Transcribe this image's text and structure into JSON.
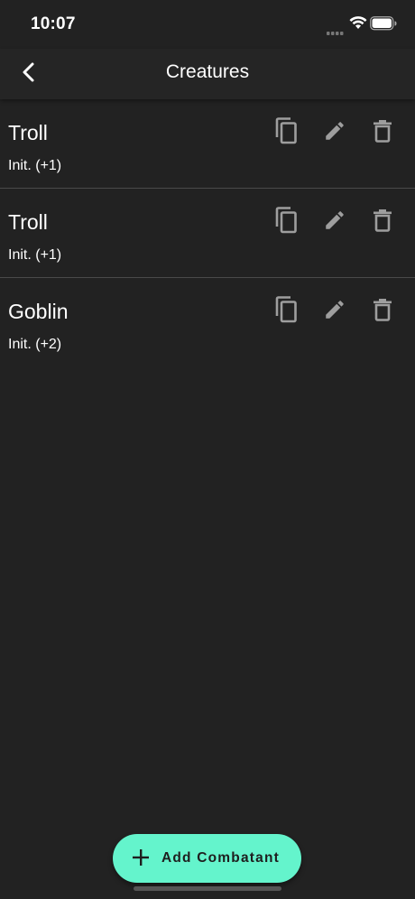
{
  "status_bar": {
    "time": "10:07"
  },
  "nav": {
    "title": "Creatures",
    "back_icon": "chevron-left-icon"
  },
  "creatures": [
    {
      "name": "Troll",
      "initiative": "Init. (+1)"
    },
    {
      "name": "Troll",
      "initiative": "Init. (+1)"
    },
    {
      "name": "Goblin",
      "initiative": "Init. (+2)"
    }
  ],
  "row_actions": [
    "copy-icon",
    "edit-icon",
    "delete-icon"
  ],
  "fab": {
    "label": "Add Combatant",
    "icon": "plus-icon"
  },
  "colors": {
    "background": "#222222",
    "accent": "#64f4cc",
    "icon_gray": "#9e9e9e"
  }
}
